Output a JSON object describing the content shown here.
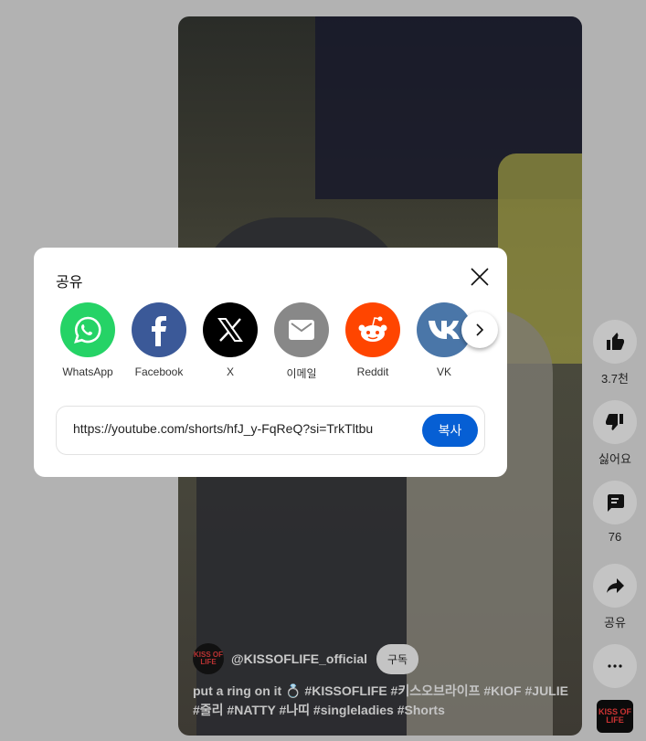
{
  "video": {
    "channel_avatar_text": "KISS OF LIFE",
    "channel_name": "@KISSOFLIFE_official",
    "subscribe_label": "구독",
    "description": "put a ring on it 💍 #KISSOFLIFE #키스오브라이프 #KIOF #JULIE #줄리 #NATTY #나띠 #singleladies #Shorts"
  },
  "actions": {
    "like_count": "3.7천",
    "dislike_label": "싫어요",
    "comment_count": "76",
    "share_label": "공유"
  },
  "share_dialog": {
    "title": "공유",
    "targets": [
      {
        "label": "WhatsApp",
        "icon": "whatsapp-icon",
        "color": "#25d366"
      },
      {
        "label": "Facebook",
        "icon": "facebook-icon",
        "color": "#3b5998"
      },
      {
        "label": "X",
        "icon": "x-icon",
        "color": "#000000"
      },
      {
        "label": "이메일",
        "icon": "email-icon",
        "color": "#888888"
      },
      {
        "label": "Reddit",
        "icon": "reddit-icon",
        "color": "#ff4500"
      },
      {
        "label": "VK",
        "icon": "vk-icon",
        "color": "#4a76a8"
      }
    ],
    "url": "https://youtube.com/shorts/hfJ_y-FqReQ?si=TrkTltbuzcH",
    "copy_label": "복사",
    "accent": "#065fd4"
  }
}
